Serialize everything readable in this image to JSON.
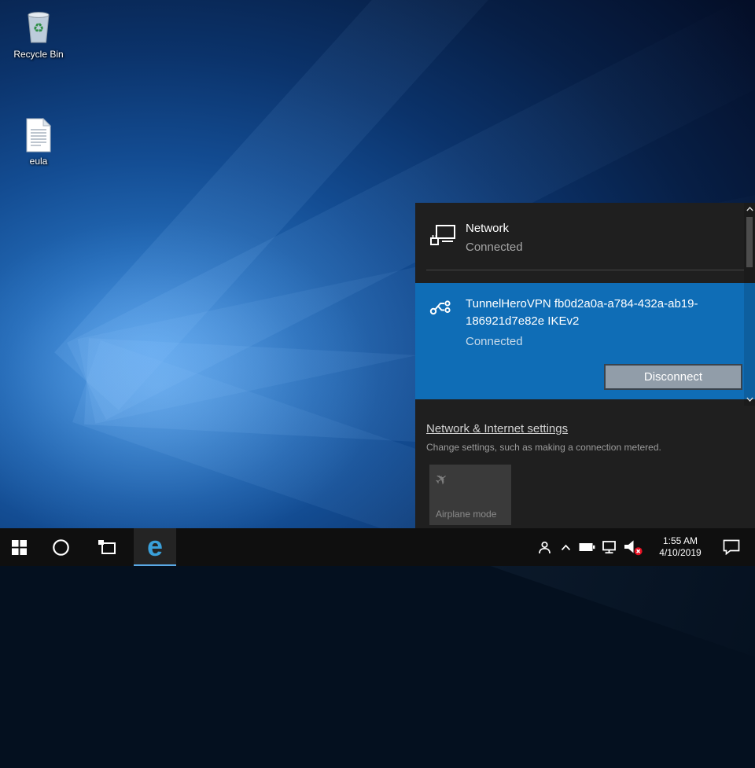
{
  "desktop": {
    "icons": [
      {
        "label": "Recycle Bin"
      },
      {
        "label": "eula"
      }
    ]
  },
  "flyout": {
    "network": {
      "title": "Network",
      "status": "Connected"
    },
    "vpn": {
      "name": "TunnelHeroVPN fb0d2a0a-a784-432a-ab19-186921d7e82e IKEv2",
      "status": "Connected",
      "action": "Disconnect"
    },
    "settings_link": "Network & Internet settings",
    "settings_hint": "Change settings, such as making a connection metered.",
    "airplane_label": "Airplane mode"
  },
  "taskbar": {
    "time": "1:55 AM",
    "date": "4/10/2019"
  },
  "icons": {
    "recycle_glyph": "♻",
    "airplane_glyph": "✈",
    "edge_glyph": "e"
  },
  "colors": {
    "accent_blue": "#0f6db6",
    "flyout_bg": "#1f1f1f",
    "taskbar_bg": "#0f0f0f",
    "mute_badge_red": "#e81123",
    "edge_blue": "#3aa0da"
  }
}
